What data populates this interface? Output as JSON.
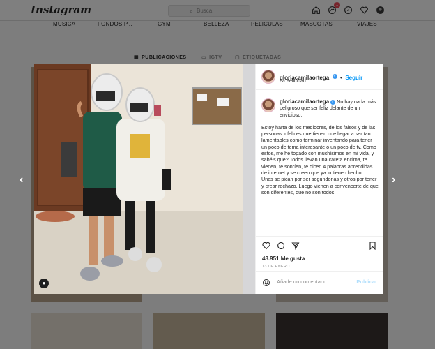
{
  "app": {
    "logo_text": "Instagram"
  },
  "search": {
    "placeholder": "Busca",
    "icon": "search-icon"
  },
  "topbar": {
    "notification_count": "1",
    "icons": [
      "home-icon",
      "direct-icon",
      "explore-icon",
      "heart-icon",
      "profile-avatar"
    ]
  },
  "highlights": [
    "MUSICA",
    "FONDOS P...",
    "GYM",
    "BELLEZA",
    "PELICULAS",
    "MASCOTAS",
    "VIAJES"
  ],
  "tabs": [
    {
      "label": "PUBLICACIONES",
      "active": true
    },
    {
      "label": "IGTV",
      "active": false
    },
    {
      "label": "ETIQUETADAS",
      "active": false
    }
  ],
  "post": {
    "username": "gloriacamilaortega",
    "follow_label": "Seguir",
    "separator": "•",
    "location": "La Felicidad",
    "caption_first": "No hay nada más peligroso que ser feliz delante de un envidioso.",
    "caption_body": "Estoy harta de los mediocres, de los falsos y de las personas infelices que tienen que llegar a ser tan lamentables como terminar inventando para tener un poco de tema interesante o un poco de tv. Como estos, me he topado con muchísimos en mi vida, y sabéis que? Todos llevan una careta encima, te vienen, te sonríen, te dicen 4 palabras aprendidas de internet y se creen que ya lo tienen hecho.\nUnas se pican por ser segundonas y otros por tener y crear rechazo. Luego vienen a convencerte de que son diferentes, que no son todos",
    "likes": "48.951 Me gusta",
    "date": "13 DE ENERO",
    "comment_placeholder": "Añade un comentario...",
    "publish_label": "Publicar"
  },
  "nav": {
    "prev": "‹",
    "next": "›"
  },
  "colors": {
    "link_blue": "#0095f6",
    "badge_red": "#ed4956",
    "verified_blue": "#3897f0"
  }
}
